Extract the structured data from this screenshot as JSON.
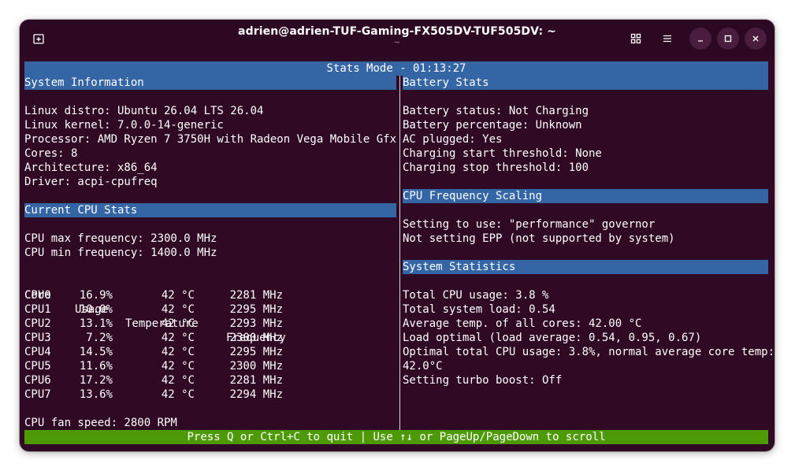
{
  "window": {
    "title": "adrien@adrien-TUF-Gaming-FX505DV-TUF505DV: ~",
    "subtitle": "~"
  },
  "header": "Stats Mode - 01:13:27",
  "left": {
    "system_info": {
      "heading": "System Information",
      "lines": [
        "Linux distro: Ubuntu 26.04 LTS 26.04",
        "Linux kernel: 7.0.0-14-generic",
        "Processor: AMD Ryzen 7 3750H with Radeon Vega Mobile Gfx",
        "Cores: 8",
        "Architecture: x86_64",
        "Driver: acpi-cpufreq"
      ]
    },
    "cpu_stats": {
      "heading": "Current CPU Stats",
      "max_freq": "CPU max frequency: 2300.0 MHz",
      "min_freq": "CPU min frequency: 1400.0 MHz",
      "columns": [
        "Core",
        "Usage",
        "Temperature",
        "Frequency"
      ],
      "rows": [
        {
          "core": "CPU0",
          "usage": "16.9%",
          "temp": "42 °C",
          "freq": "2281 MHz"
        },
        {
          "core": "CPU1",
          "usage": "10.0%",
          "temp": "42 °C",
          "freq": "2295 MHz"
        },
        {
          "core": "CPU2",
          "usage": "13.1%",
          "temp": "42 °C",
          "freq": "2293 MHz"
        },
        {
          "core": "CPU3",
          "usage": "7.2%",
          "temp": "42 °C",
          "freq": "2300 MHz"
        },
        {
          "core": "CPU4",
          "usage": "14.5%",
          "temp": "42 °C",
          "freq": "2295 MHz"
        },
        {
          "core": "CPU5",
          "usage": "11.6%",
          "temp": "42 °C",
          "freq": "2300 MHz"
        },
        {
          "core": "CPU6",
          "usage": "17.2%",
          "temp": "42 °C",
          "freq": "2281 MHz"
        },
        {
          "core": "CPU7",
          "usage": "13.6%",
          "temp": "42 °C",
          "freq": "2294 MHz"
        }
      ],
      "fan_speed": "CPU fan speed: 2800 RPM"
    }
  },
  "right": {
    "battery": {
      "heading": "Battery Stats",
      "lines": [
        "Battery status: Not Charging",
        "Battery percentage: Unknown",
        "AC plugged: Yes",
        "Charging start threshold: None",
        "Charging stop threshold: 100"
      ]
    },
    "scaling": {
      "heading": "CPU Frequency Scaling",
      "lines": [
        "Setting to use: \"performance\" governor",
        "Not setting EPP (not supported by system)"
      ]
    },
    "system_stats": {
      "heading": "System Statistics",
      "lines": [
        "Total CPU usage: 3.8 %",
        "Total system load: 0.54",
        "Average temp. of all cores: 42.00 °C",
        "Load optimal (load average: 0.54, 0.95, 0.67)",
        "Optimal total CPU usage: 3.8%, normal average core temp:",
        "42.0°C",
        "Setting turbo boost: Off"
      ]
    }
  },
  "footer": "Press Q or Ctrl+C to quit | Use ↑↓ or PageUp/PageDown to scroll",
  "colors": {
    "background": "#300a24",
    "section_bar": "#3465a4",
    "footer_bar": "#4e9a06"
  },
  "icons": {
    "new_tab": "new-tab-icon",
    "grid": "grid-icon",
    "menu": "hamburger-menu-icon",
    "minimize": "minimize-icon",
    "maximize": "maximize-icon",
    "close": "close-icon"
  }
}
